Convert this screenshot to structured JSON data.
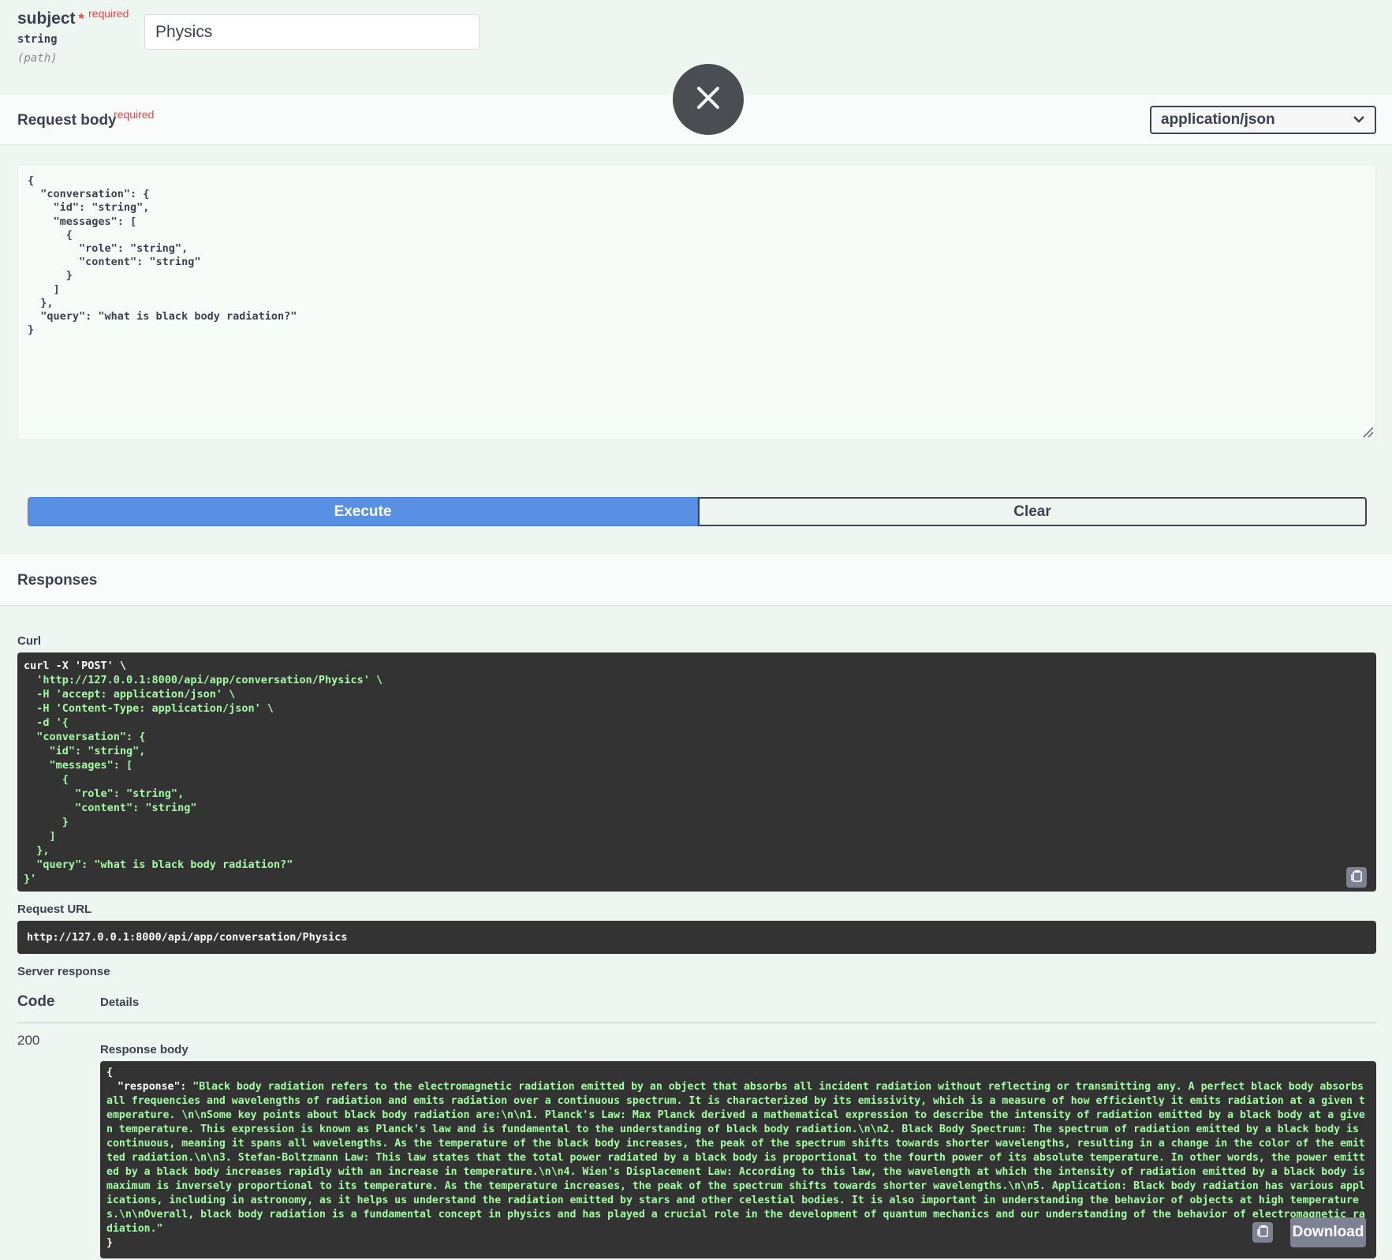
{
  "parameter": {
    "name": "subject",
    "star": "*",
    "required_label": "required",
    "type": "string",
    "location": "(path)",
    "value": "Physics"
  },
  "request_body": {
    "title": "Request body",
    "required_label": "required",
    "content_type": "application/json",
    "example": "{\n  \"conversation\": {\n    \"id\": \"string\",\n    \"messages\": [\n      {\n        \"role\": \"string\",\n        \"content\": \"string\"\n      }\n    ]\n  },\n  \"query\": \"what is black body radiation?\"\n}"
  },
  "buttons": {
    "execute": "Execute",
    "clear": "Clear",
    "download": "Download"
  },
  "responses": {
    "title": "Responses",
    "curl_label": "Curl",
    "curl_lines": [
      "curl -X 'POST' \\",
      "  'http://127.0.0.1:8000/api/app/conversation/Physics' \\",
      "  -H 'accept: application/json' \\",
      "  -H 'Content-Type: application/json' \\",
      "  -d '{",
      "  \"conversation\": {",
      "    \"id\": \"string\",",
      "    \"messages\": [",
      "      {",
      "        \"role\": \"string\",",
      "        \"content\": \"string\"",
      "      }",
      "    ]",
      "  },",
      "  \"query\": \"what is black body radiation?\"",
      "}'"
    ],
    "request_url_label": "Request URL",
    "request_url": "http://127.0.0.1:8000/api/app/conversation/Physics",
    "server_response_label": "Server response",
    "code_header": "Code",
    "details_header": "Details",
    "code": "200",
    "response_body_label": "Response body",
    "response_open": "{",
    "response_key": "\"response\":",
    "response_text": "\"Black body radiation refers to the electromagnetic radiation emitted by an object that absorbs all incident radiation without reflecting or transmitting any. A perfect black body absorbs all frequencies and wavelengths of radiation and emits radiation over a continuous spectrum. It is characterized by its emissivity, which is a measure of how efficiently it emits radiation at a given temperature. \\n\\nSome key points about black body radiation are:\\n\\n1. Planck's Law: Max Planck derived a mathematical expression to describe the intensity of radiation emitted by a black body at a given temperature. This expression is known as Planck's law and is fundamental to the understanding of black body radiation.\\n\\n2. Black Body Spectrum: The spectrum of radiation emitted by a black body is continuous, meaning it spans all wavelengths. As the temperature of the black body increases, the peak of the spectrum shifts towards shorter wavelengths, resulting in a change in the color of the emitted radiation.\\n\\n3. Stefan-Boltzmann Law: This law states that the total power radiated by a black body is proportional to the fourth power of its absolute temperature. In other words, the power emitted by a black body increases rapidly with an increase in temperature.\\n\\n4. Wien's Displacement Law: According to this law, the wavelength at which the intensity of radiation emitted by a black body is maximum is inversely proportional to its temperature. As the temperature increases, the peak of the spectrum shifts towards shorter wavelengths.\\n\\n5. Application: Black body radiation has various applications, including in astronomy, as it helps us understand the radiation emitted by stars and other celestial bodies. It is also important in understanding the behavior of objects at high temperatures.\\n\\nOverall, black body radiation is a fundamental concept in physics and has played a crucial role in the development of quantum mechanics and our understanding of the behavior of electromagnetic radiation.\"",
    "response_close": "}"
  },
  "icons": {
    "close": "close-icon",
    "chevron": "chevron-down-icon",
    "copy": "copy-icon"
  }
}
